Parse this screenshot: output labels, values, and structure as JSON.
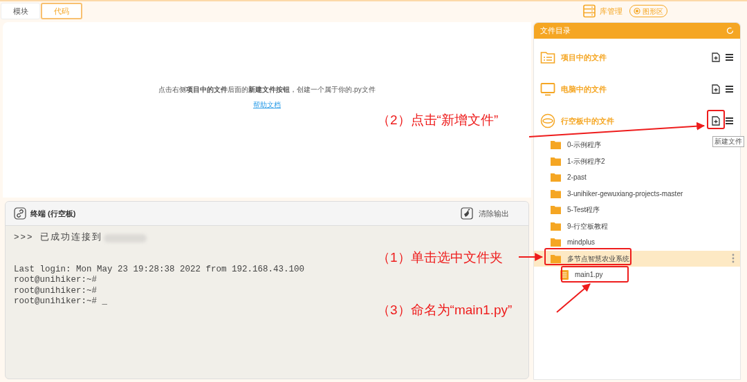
{
  "mode_tabs": [
    {
      "label": "模块",
      "selected": false
    },
    {
      "label": "代码",
      "selected": true
    }
  ],
  "toolbar": {
    "library_button": "库管理",
    "graphics_button": "图形区"
  },
  "editor": {
    "hint": "点击右侧**项目中的文件**后面的**新建文件按钮**，创建一个属于你的.py文件",
    "help_link": "帮助文档"
  },
  "terminal": {
    "title": "终端 (行空板)",
    "clear_button": "清除输出",
    "connect_line": ">>> 已成功连接到",
    "lines": [
      "Last login: Mon May 23 19:28:38 2022 from 192.168.43.100",
      "root@unihiker:~#",
      "root@unihiker:~#",
      "root@unihiker:~# _"
    ]
  },
  "file_panel": {
    "title": "文件目录",
    "sections": [
      {
        "label": "项目中的文件",
        "kind": "project"
      },
      {
        "label": "电脑中的文件",
        "kind": "computer"
      },
      {
        "label": "行空板中的文件",
        "kind": "board"
      }
    ],
    "tooltip": "新建文件",
    "tree": [
      {
        "name": "0-示例程序",
        "kind": "folder",
        "selected": false
      },
      {
        "name": "1-示例程序2",
        "kind": "folder",
        "selected": false
      },
      {
        "name": "2-past",
        "kind": "folder",
        "selected": false
      },
      {
        "name": "3-unihiker-gewuxiang-projects-master",
        "kind": "folder",
        "selected": false
      },
      {
        "name": "5-Test程序",
        "kind": "folder",
        "selected": false
      },
      {
        "name": "9-行空板教程",
        "kind": "folder",
        "selected": false
      },
      {
        "name": "mindplus",
        "kind": "folder",
        "selected": false
      },
      {
        "name": "多节点智慧农业系统",
        "kind": "folder",
        "selected": true,
        "children": [
          {
            "name": "main1.py",
            "kind": "file",
            "selected": false
          }
        ]
      }
    ]
  },
  "annotations": [
    {
      "text": "（2）点击“新增文件”"
    },
    {
      "text": "（1）单击选中文件夹"
    },
    {
      "text": "（3）命名为“main1.py”"
    }
  ]
}
